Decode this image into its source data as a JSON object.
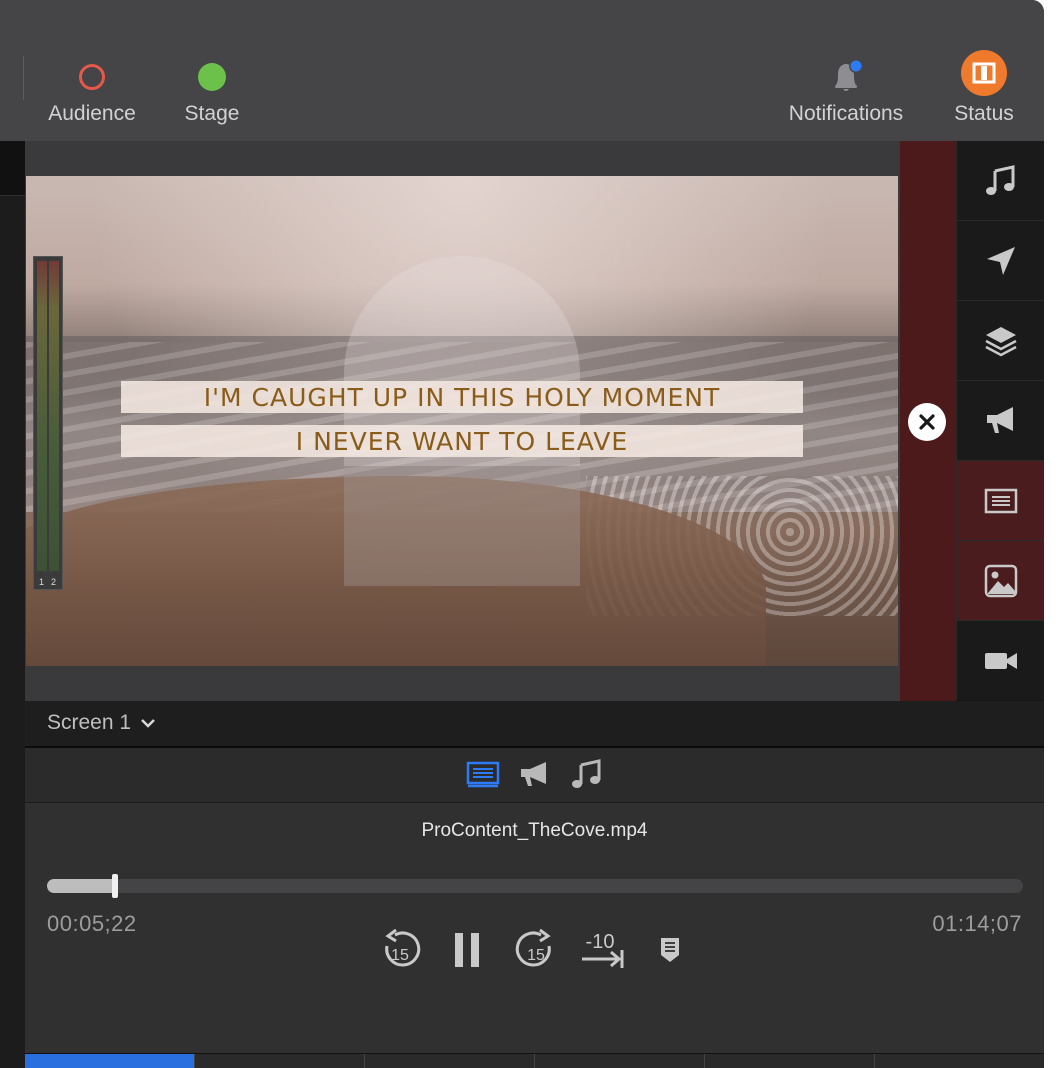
{
  "toolbar": {
    "audience_label": "Audience",
    "stage_label": "Stage",
    "notifications_label": "Notifications",
    "status_label": "Status",
    "audience_color": "#e8584a",
    "stage_color": "#6cc14a",
    "notification_dot_color": "#2f7bf5",
    "status_color": "#f07a2c"
  },
  "preview": {
    "lyric_line_1": "I'M CAUGHT UP IN THIS HOLY MOMENT",
    "lyric_line_2": "I NEVER WANT TO LEAVE",
    "meter_channel_1": "1",
    "meter_channel_2": "2"
  },
  "right_bar": {
    "items": [
      {
        "icon": "music-note-icon",
        "active": false
      },
      {
        "icon": "send-icon",
        "active": false
      },
      {
        "icon": "layers-icon",
        "active": false
      },
      {
        "icon": "megaphone-icon",
        "active": false
      },
      {
        "icon": "slide-text-icon",
        "active": true
      },
      {
        "icon": "image-icon",
        "active": true
      },
      {
        "icon": "video-camera-icon",
        "active": false
      }
    ]
  },
  "screen_selector": {
    "label": "Screen 1"
  },
  "layer_tabs": [
    {
      "icon": "slide-text-icon",
      "selected": true
    },
    {
      "icon": "megaphone-icon",
      "selected": false
    },
    {
      "icon": "music-note-icon",
      "selected": false
    }
  ],
  "media": {
    "filename": "ProContent_TheCove.mp4",
    "elapsed": "00:05;22",
    "total": "01:14;07",
    "progress": 0.07,
    "skip_back_label": "15",
    "skip_forward_label": "15",
    "minus_ten_label": "-10"
  }
}
